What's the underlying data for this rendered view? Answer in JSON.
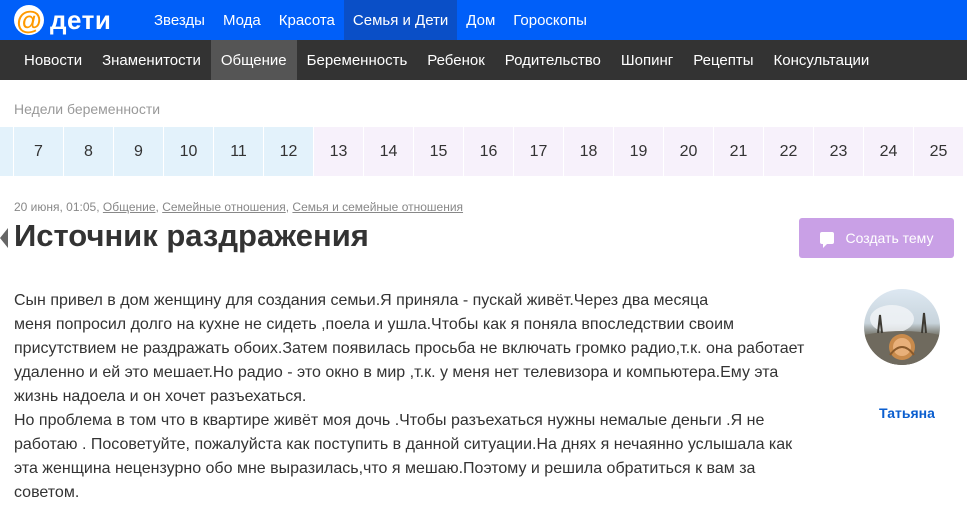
{
  "logo": {
    "at": "@",
    "text": "дети"
  },
  "topnav": [
    "Звезды",
    "Мода",
    "Красота",
    "Семья и Дети",
    "Дом",
    "Гороскопы"
  ],
  "subnav": [
    "Новости",
    "Знаменитости",
    "Общение",
    "Беременность",
    "Ребенок",
    "Родительство",
    "Шопинг",
    "Рецепты",
    "Консультации"
  ],
  "weeks": {
    "label": "Недели беременности",
    "items": [
      "7",
      "8",
      "9",
      "10",
      "11",
      "12",
      "13",
      "14",
      "15",
      "16",
      "17",
      "18",
      "19",
      "20",
      "21",
      "22",
      "23",
      "24",
      "25"
    ]
  },
  "post": {
    "date": "20 июня, 01:05,",
    "categories": [
      "Общение",
      "Семейные отношения",
      "Семья и семейные отношения"
    ],
    "title": "Источник раздражения",
    "body": [
      "Сын привел в дом женщину для создания семьи.Я приняла - пускай живёт.Через два месяца",
      "меня попросил долго на кухне не сидеть ,поела и ушла.Чтобы как я поняла впоследствии своим",
      "присутствием не раздражать обоих.Затем появилась просьба не включать громко радио,т.к. она работает",
      "удаленно и ей это мешает.Но радио - это окно в мир ,т.к. у меня нет телевизора и компьютера.Ему эта",
      "жизнь надоела и он хочет разъехаться.",
      "Но проблема в том что в квартире живёт моя дочь .Чтобы разъехаться нужны немалые деньги .Я не",
      "работаю . Посоветуйте, пожалуйста как поступить в данной ситуации.На днях я нечаянно услышала как",
      "эта женщина нецензурно обо мне выразилась,что я мешаю.Поэтому и решила обратиться к вам за",
      "советом."
    ],
    "author": "Татьяна"
  },
  "create_button": "Создать тему",
  "colors": {
    "brand": "#005ff9",
    "subbar": "#333333",
    "button": "#c9a0e6",
    "author": "#0a5ecf"
  }
}
